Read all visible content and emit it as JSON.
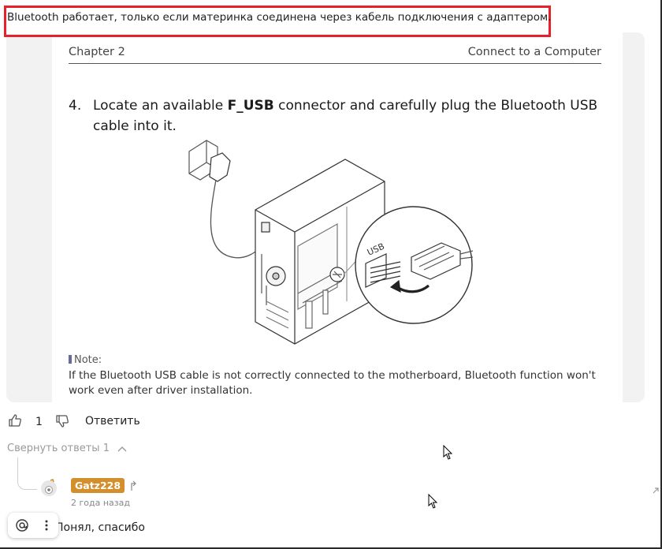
{
  "annotation": {
    "text": "Bluetooth работает, только если материнка соединена через кабель подключения с адаптером.",
    "border_color": "#e8202a"
  },
  "manual_page": {
    "chapter": "Chapter 2",
    "section": "Connect to a Computer",
    "step_number": "4.",
    "step_text_before": "Locate an available ",
    "step_text_bold": "F_USB",
    "step_text_after": " connector and carefully plug the Bluetooth USB cable into it.",
    "usb_label": "USB",
    "note_label": "Note:",
    "note_text": "If the Bluetooth USB cable is not correctly connected to the motherboard, Bluetooth function won't work even after driver installation."
  },
  "comment_actions": {
    "like_icon": "thumbs-up-icon",
    "like_count": "1",
    "dislike_icon": "thumbs-down-icon",
    "reply_label": "Ответить"
  },
  "thread": {
    "collapse_label": "Свернуть ответы 1",
    "collapse_icon": "chevron-up-icon"
  },
  "reply": {
    "username": "Gatz228",
    "username_badge_color": "#d28f2c",
    "timestamp": "2 года назад",
    "body": "Понял, спасибо"
  },
  "floating_toolbar": {
    "icons": [
      "at-sign-icon",
      "more-vertical-icon"
    ]
  }
}
